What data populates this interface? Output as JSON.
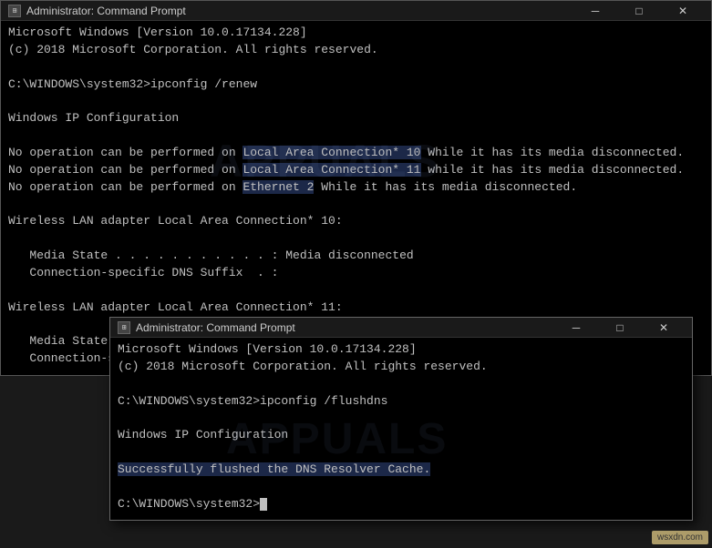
{
  "top_window": {
    "title": "Administrator: Command Prompt",
    "titlebar_icon": "⊞",
    "lines": [
      "Microsoft Windows [Version 10.0.17134.228]",
      "(c) 2018 Microsoft Corporation. All rights reserved.",
      "",
      "C:\\WINDOWS\\system32>ipconfig /renew",
      "",
      "Windows IP Configuration",
      "",
      "No operation can be performed on Local Area Connection* 10 While it has its media disconnected.",
      "No operation can be performed on Local Area Connection* 11 while it has its media disconnected.",
      "No operation can be performed on Ethernet 2 While it has its media disconnected.",
      "",
      "Wireless LAN adapter Local Area Connection* 10:",
      "",
      "   Media State . . . . . . . . . . . : Media disconnected",
      "   Connection-specific DNS Suffix  . :",
      "",
      "Wireless LAN adapter Local Area Connection* 11:",
      "",
      "   Media State . . . . . . . . . . . : Media disconnected",
      "   Connection-specific DNS Suffix  . :"
    ]
  },
  "bottom_window": {
    "title": "Administrator: Command Prompt",
    "titlebar_icon": "⊞",
    "lines": [
      "Microsoft Windows [Version 10.0.17134.228]",
      "(c) 2018 Microsoft Corporation. All rights reserved.",
      "",
      "C:\\WINDOWS\\system32>ipconfig /flushdns",
      "",
      "Windows IP Configuration",
      "",
      "Successfully flushed the DNS Resolver Cache.",
      "",
      "C:\\WINDOWS\\system32>"
    ]
  },
  "watermark": {
    "text": "APPUALS",
    "top1": "158",
    "left1": "240",
    "top2": "460",
    "left2": "260"
  },
  "wsxdn": "wsxdn.com",
  "buttons": {
    "minimize": "─",
    "maximize": "□",
    "close": "✕"
  }
}
